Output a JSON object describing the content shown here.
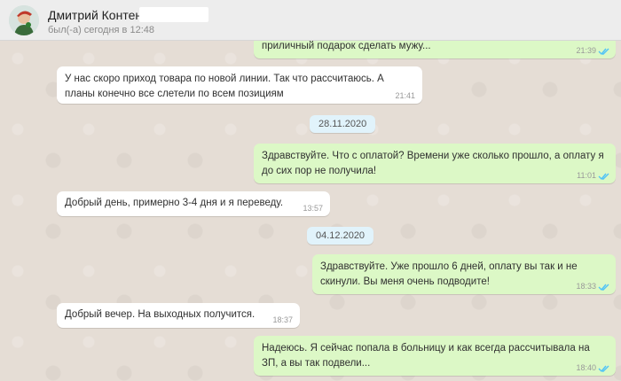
{
  "header": {
    "contact_name": "Дмитрий Контент",
    "last_seen": "был(-а) сегодня в 12:48"
  },
  "messages": [
    {
      "direction": "out",
      "text": "приличный подарок сделать мужу...",
      "time": "21:39"
    },
    {
      "direction": "in",
      "text": "У нас скоро приход товара по новой линии. Так что рассчитаюсь. А планы конечно все слетели по всем позициям",
      "time": "21:41"
    },
    {
      "direction": "date",
      "text": "28.11.2020"
    },
    {
      "direction": "out",
      "text": "Здравствуйте. Что с оплатой? Времени уже сколько прошло, а оплату я до сих пор не получила!",
      "time": "11:01"
    },
    {
      "direction": "in",
      "text": "Добрый день, примерно 3-4 дня и я переведу.",
      "time": "13:57"
    },
    {
      "direction": "date",
      "text": "04.12.2020"
    },
    {
      "direction": "out",
      "text": "Здравствуйте. Уже прошло 6 дней, оплату вы так и не скинули. Вы меня очень подводите!",
      "time": "18:33"
    },
    {
      "direction": "in",
      "text": "Добрый вечер. На выходных получится.",
      "time": "18:37"
    },
    {
      "direction": "out",
      "text": "Надеюсь. Я сейчас попала в больницу и как всегда рассчитывала на ЗП, а вы так подвели...",
      "time": "18:40"
    }
  ],
  "icons": {
    "avatar": "contact-avatar",
    "read_receipt": "double-check-icon"
  },
  "colors": {
    "incoming_bubble": "#ffffff",
    "outgoing_bubble": "#dcf8c6",
    "chat_background": "#e5ddd5",
    "date_pill": "#e1f3fb",
    "read_ticks": "#4fc3f7"
  }
}
